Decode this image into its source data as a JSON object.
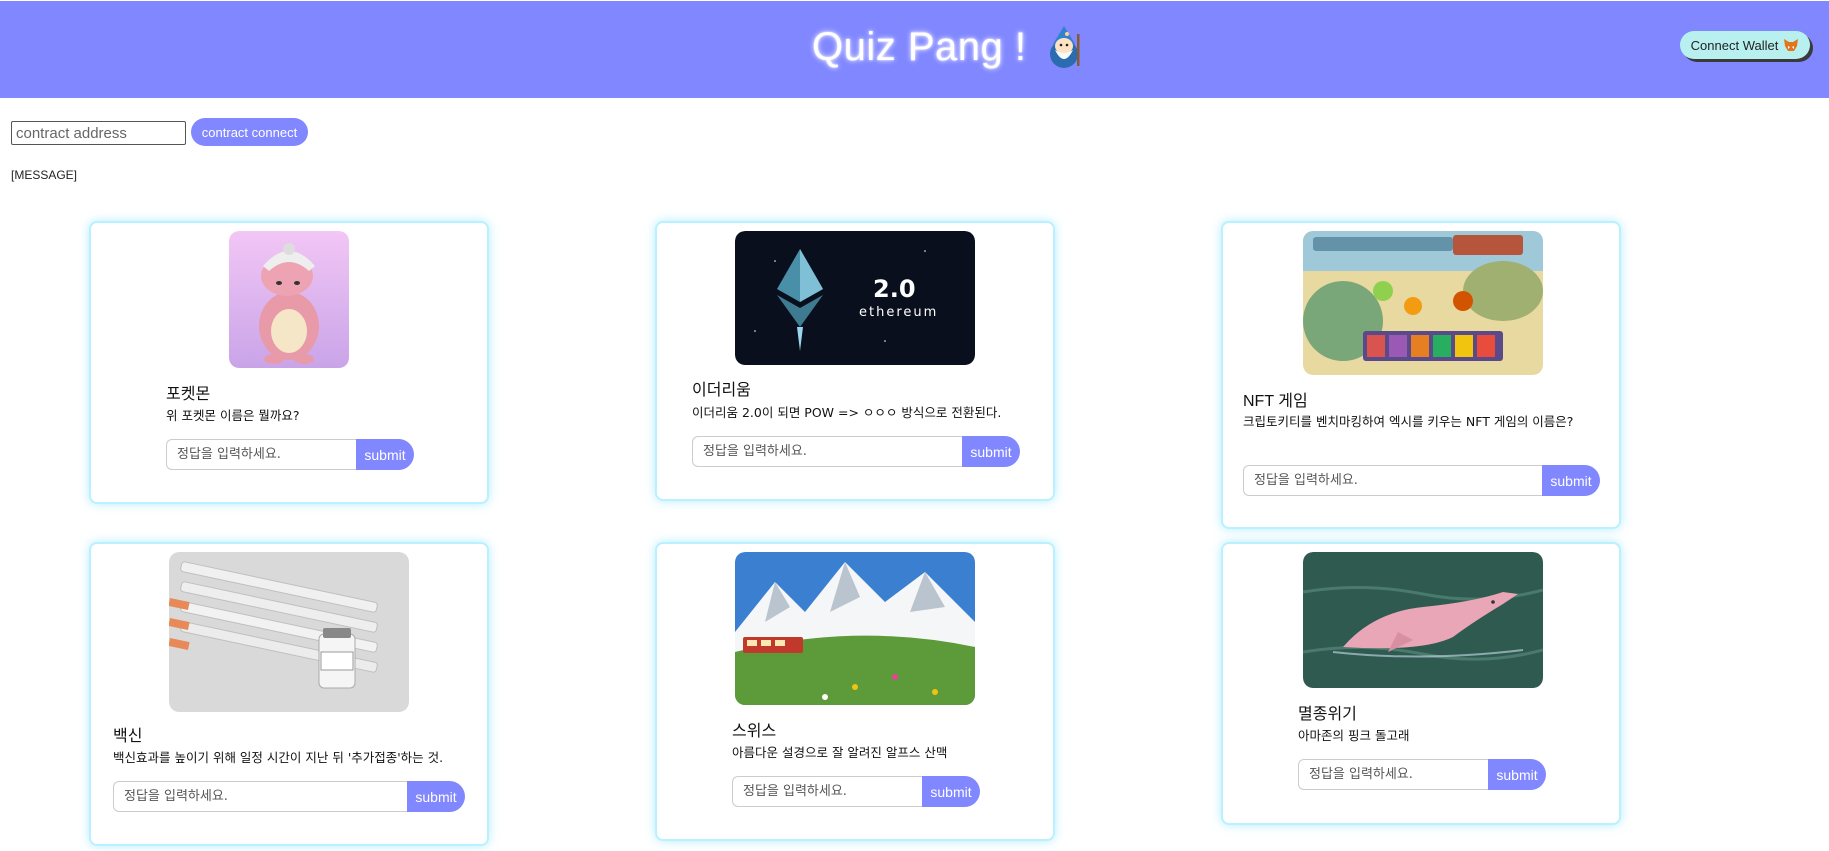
{
  "header": {
    "title": "Quiz Pang !",
    "wizard_icon": "wizard-icon",
    "wallet_button": {
      "label": "Connect Wallet",
      "icon": "metamask-fox-icon"
    },
    "background": "#8087ff"
  },
  "contract": {
    "input_placeholder": "contract address",
    "input_value": "",
    "connect_label": "contract connect"
  },
  "message": "[MESSAGE]",
  "quizzes": [
    {
      "title": "포켓몬",
      "question": "위 포켓몬 이름은 뭘까요?",
      "answer_placeholder": "정답을 입력하세요.",
      "submit_label": "submit",
      "image": "pokemon-slowking"
    },
    {
      "title": "이더리움",
      "question": "이더리움 2.0이 되면 POW => ㅇㅇㅇ 방식으로 전환된다.",
      "answer_placeholder": "정답을 입력하세요.",
      "submit_label": "submit",
      "image": "ethereum-2.0",
      "image_text": [
        "2.0",
        "ethereum"
      ]
    },
    {
      "title": "NFT 게임",
      "question": "크립토키티를 벤치마킹하여 엑시를 키우는 NFT 게임의 이름은?",
      "answer_placeholder": "정답을 입력하세요.",
      "submit_label": "submit",
      "image": "nft-game-screenshot"
    },
    {
      "title": "백신",
      "question": "백신효과를 높이기 위해 일정 시간이 지난 뒤 '추가접종'하는 것.",
      "answer_placeholder": "정답을 입력하세요.",
      "submit_label": "submit",
      "image": "vaccine-syringes"
    },
    {
      "title": "스위스",
      "question": "아름다운 설경으로 잘 알려진 알프스 산맥",
      "answer_placeholder": "정답을 입력하세요.",
      "submit_label": "submit",
      "image": "swiss-alps-train"
    },
    {
      "title": "멸종위기",
      "question": "아마존의 핑크 돌고래",
      "answer_placeholder": "정답을 입력하세요.",
      "submit_label": "submit",
      "image": "pink-river-dolphin"
    }
  ],
  "colors": {
    "accent": "#8087ff",
    "card_border": "#b9f1ff",
    "wallet_button": "#b8f0f0"
  }
}
